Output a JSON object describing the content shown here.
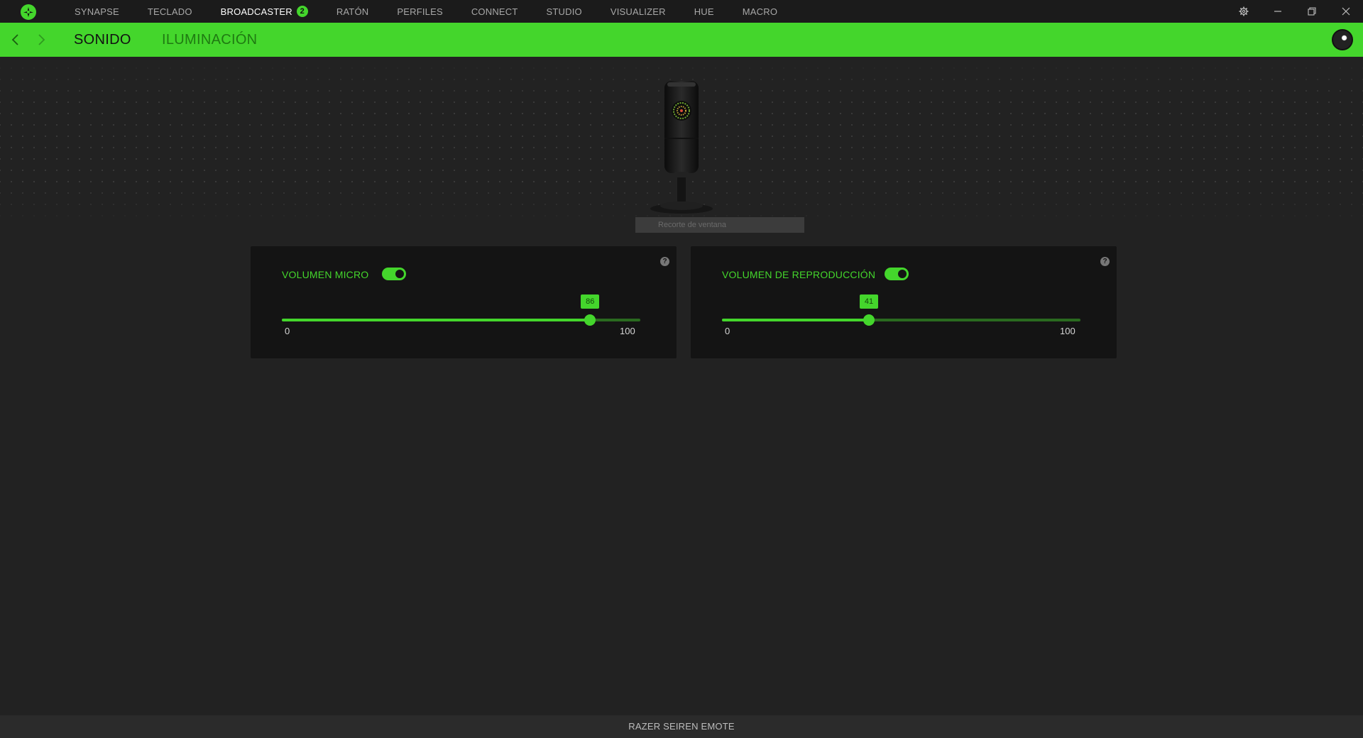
{
  "nav": {
    "items": [
      {
        "label": "SYNAPSE",
        "active": false
      },
      {
        "label": "TECLADO",
        "active": false
      },
      {
        "label": "BROADCASTER",
        "active": true,
        "badge": "2"
      },
      {
        "label": "RATÓN",
        "active": false
      },
      {
        "label": "PERFILES",
        "active": false
      },
      {
        "label": "CONNECT",
        "active": false
      },
      {
        "label": "STUDIO",
        "active": false
      },
      {
        "label": "VISUALIZER",
        "active": false
      },
      {
        "label": "HUE",
        "active": false
      },
      {
        "label": "MACRO",
        "active": false
      }
    ],
    "window_controls": [
      "gear-icon",
      "minimize-icon",
      "restore-icon",
      "close-icon"
    ]
  },
  "subheader": {
    "tabs": [
      {
        "label": "SONIDO",
        "active": true
      },
      {
        "label": "ILUMINACIÓN",
        "active": false
      }
    ]
  },
  "device": {
    "tooltip": "Recorte de ventana"
  },
  "cards": {
    "mic_volume": {
      "title": "VOLUMEN MICRO",
      "enabled": true,
      "value": "86",
      "min": "0",
      "max": "100"
    },
    "playback_volume": {
      "title": "VOLUMEN DE REPRODUCCIÓN",
      "enabled": true,
      "value": "41",
      "min": "0",
      "max": "100"
    }
  },
  "footer": {
    "device_name": "RAZER SEIREN EMOTE"
  },
  "colors": {
    "accent": "#44d62c",
    "background": "#222222",
    "card": "#141414",
    "titlebar": "#1b1b1b"
  }
}
